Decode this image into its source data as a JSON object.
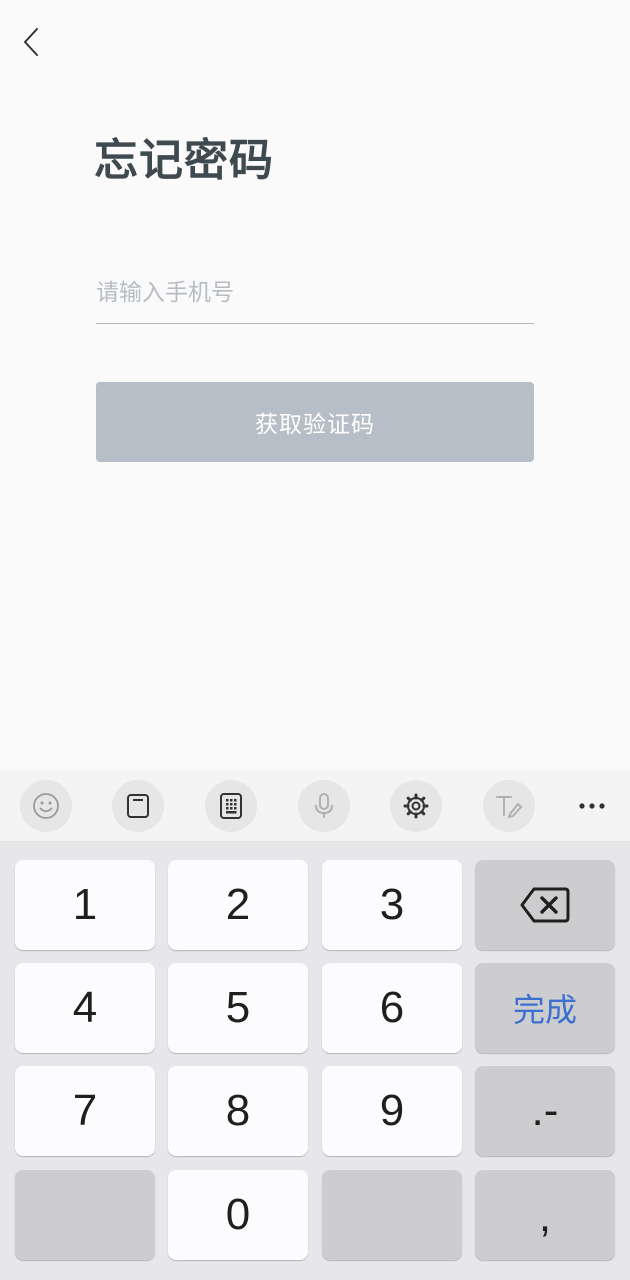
{
  "page": {
    "title": "忘记密码",
    "phone_placeholder": "请输入手机号",
    "phone_value": "",
    "get_code_label": "获取验证码"
  },
  "toolbar": {
    "tools": [
      {
        "name": "emoji-icon"
      },
      {
        "name": "clipboard-icon"
      },
      {
        "name": "keyboard-layout-icon"
      },
      {
        "name": "microphone-icon"
      },
      {
        "name": "settings-icon"
      },
      {
        "name": "handwriting-icon"
      },
      {
        "name": "more-icon"
      }
    ]
  },
  "keyboard": {
    "keys": [
      "1",
      "2",
      "3",
      "4",
      "5",
      "6",
      "7",
      "8",
      "9",
      "0"
    ],
    "done_label": "完成",
    "dot_dash_label": ".-",
    "comma_label": ",",
    "backspace_icon": "backspace-icon"
  },
  "colors": {
    "title": "#3e4950",
    "button_disabled": "#b6bec7",
    "done_text": "#3c6fd0",
    "function_key": "#cdcdcf",
    "keypad_bg": "#e7e7e9"
  }
}
